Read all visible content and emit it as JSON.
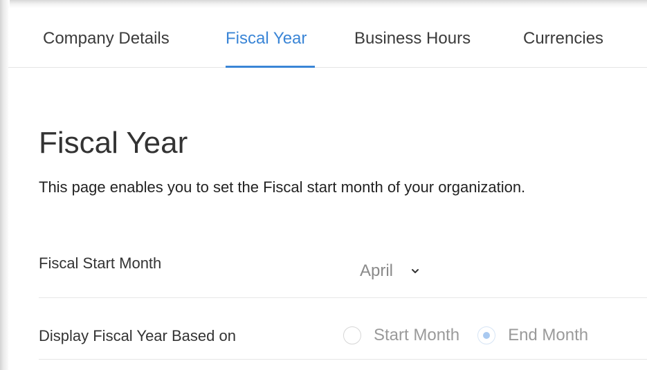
{
  "tabs": [
    {
      "label": "Company Details",
      "active": false
    },
    {
      "label": "Fiscal Year",
      "active": true
    },
    {
      "label": "Business Hours",
      "active": false
    },
    {
      "label": "Currencies",
      "active": false
    }
  ],
  "page": {
    "title": "Fiscal Year",
    "description": "This page enables you to set the Fiscal start month of your organization."
  },
  "fields": {
    "fiscal_start_month": {
      "label": "Fiscal Start Month",
      "selected": "April",
      "icon": "chevron-down-icon"
    },
    "display_based_on": {
      "label": "Display Fiscal Year Based on",
      "options": [
        {
          "label": "Start Month",
          "checked": false
        },
        {
          "label": "End Month",
          "checked": true
        }
      ]
    }
  },
  "colors": {
    "accent": "#3a85d6",
    "muted_text": "#9a9a9a",
    "divider": "#e6e6e6"
  }
}
